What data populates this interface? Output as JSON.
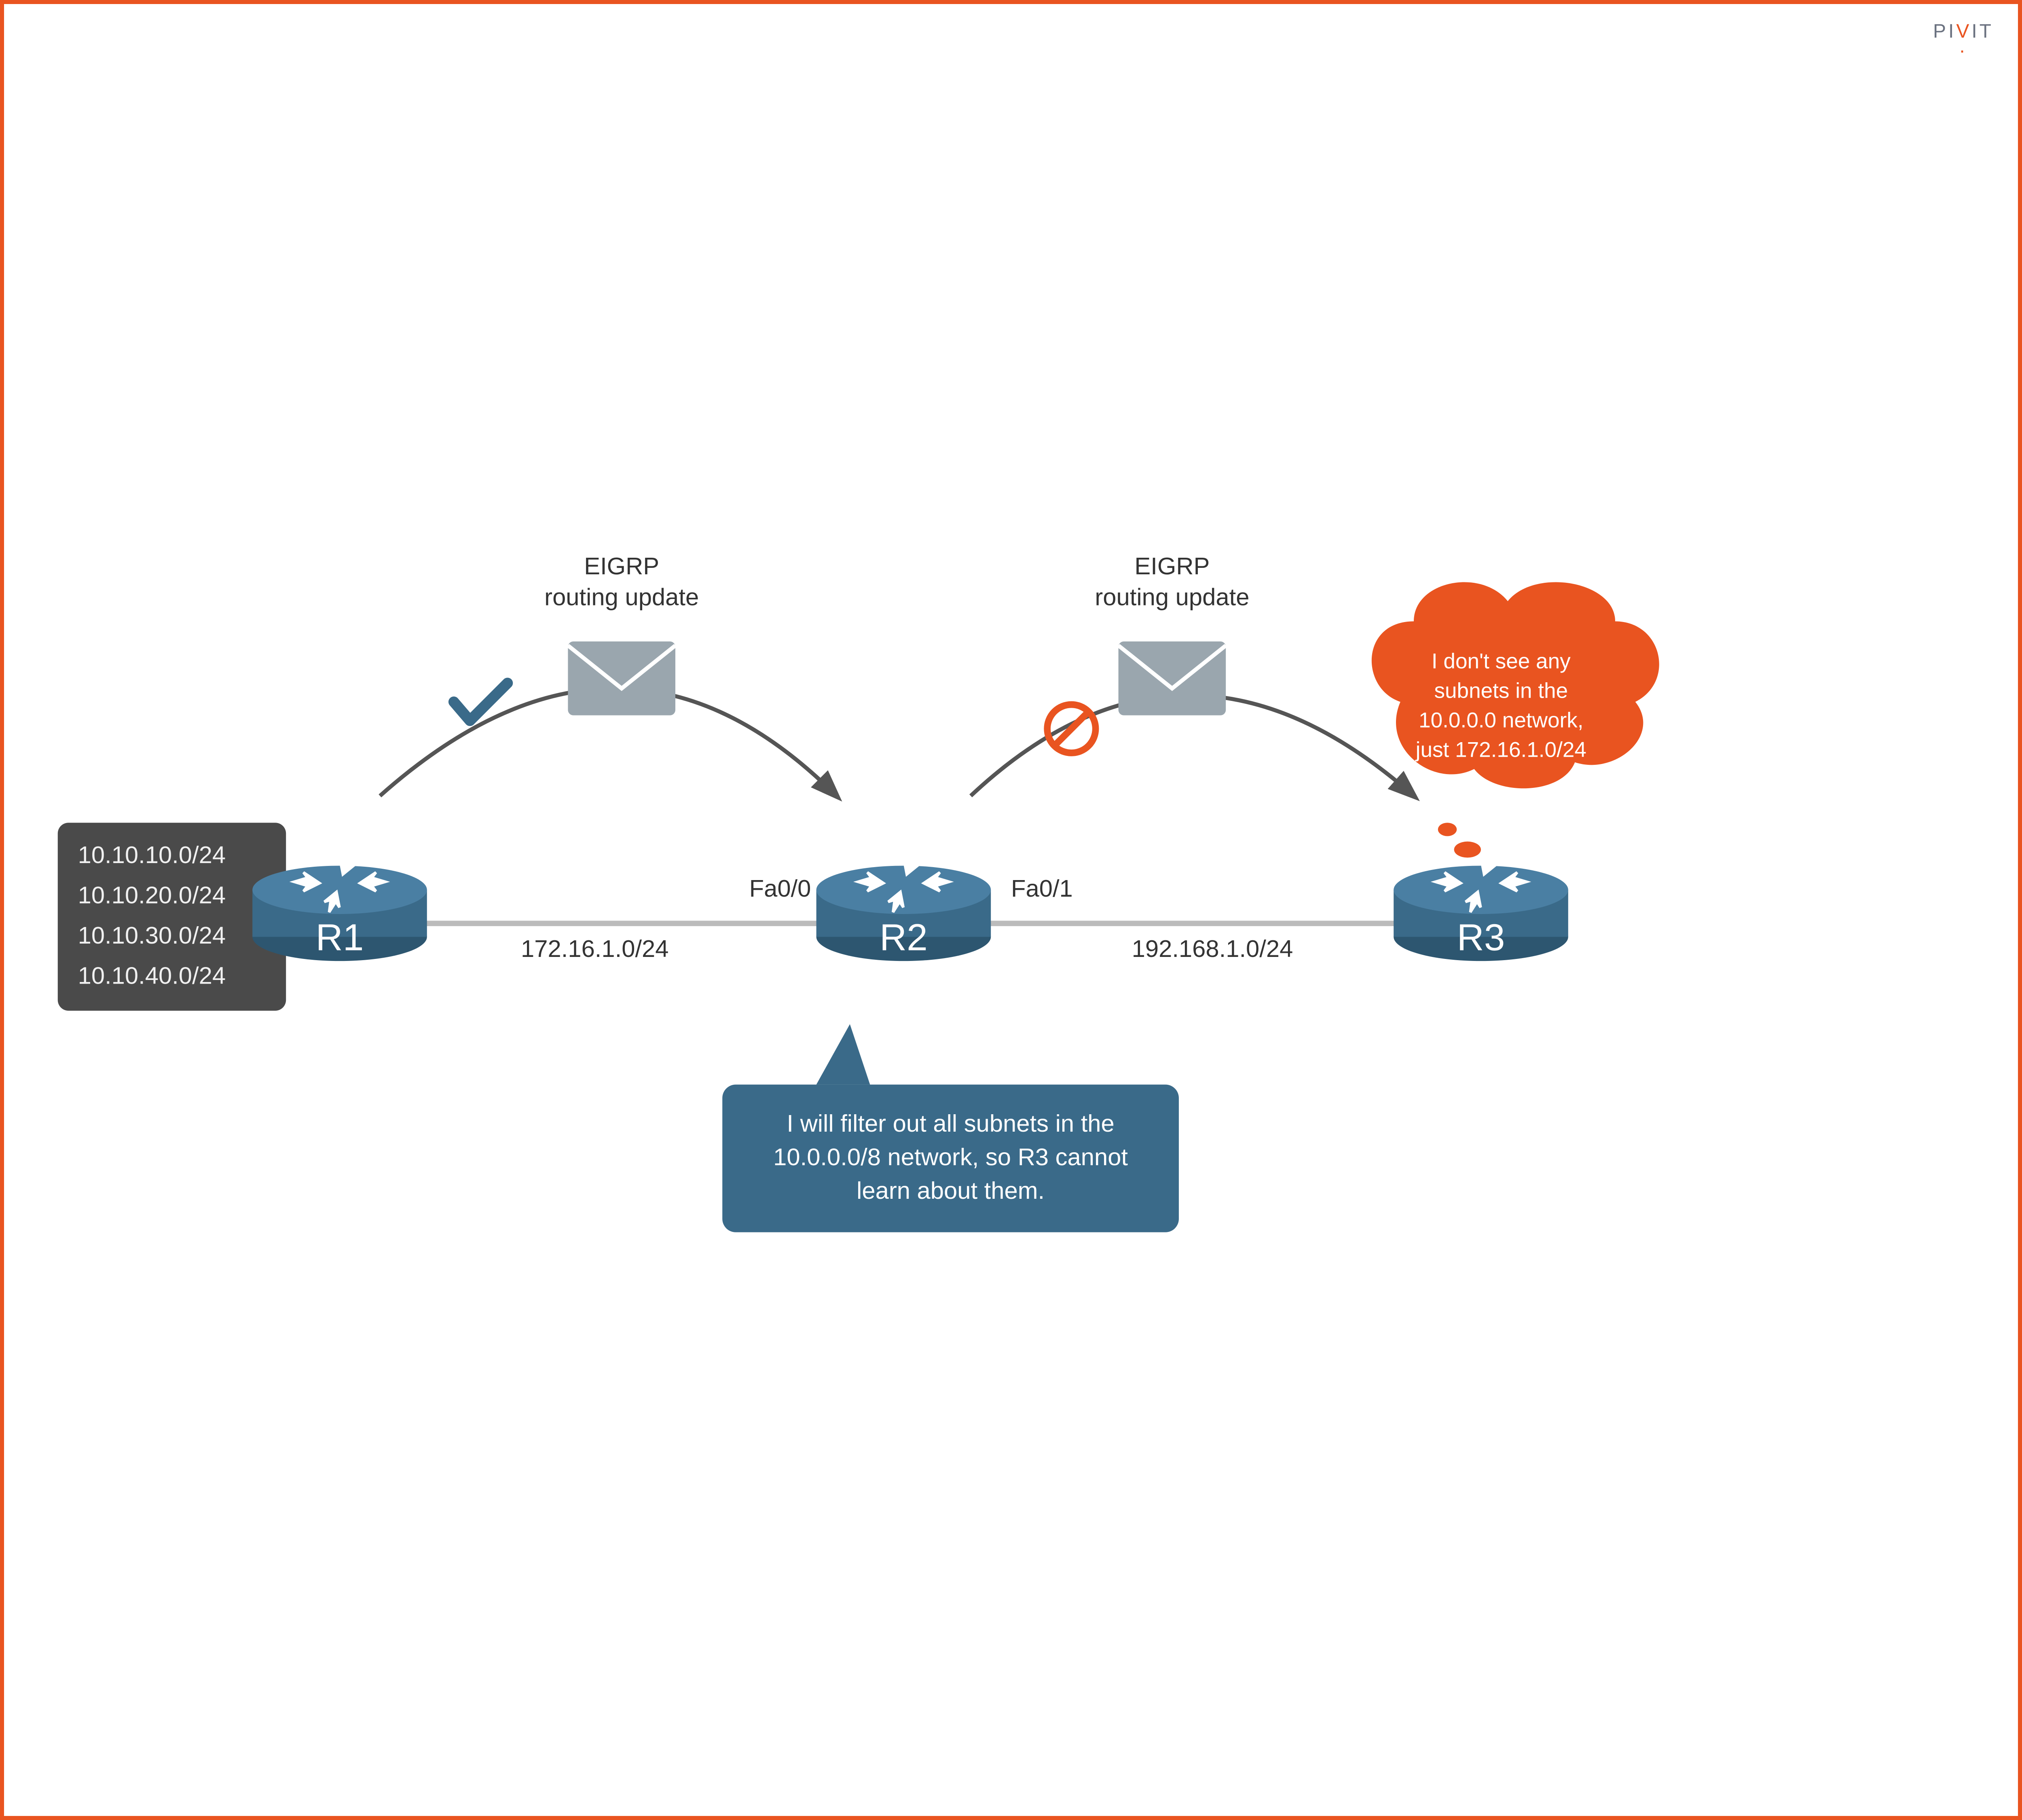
{
  "brand": {
    "name_left": "PI",
    "name_mid": "V",
    "name_right": "IT"
  },
  "subnets_box": [
    "10.10.10.0/24",
    "10.10.20.0/24",
    "10.10.30.0/24",
    "10.10.40.0/24"
  ],
  "routers": {
    "r1": "R1",
    "r2": "R2",
    "r3": "R3"
  },
  "interfaces": {
    "r2_left": "Fa0/0",
    "r2_right": "Fa0/1"
  },
  "links": {
    "r1_r2": "172.16.1.0/24",
    "r2_r3": "192.168.1.0/24"
  },
  "updates": {
    "left_line1": "EIGRP",
    "left_line2": "routing update",
    "right_line1": "EIGRP",
    "right_line2": "routing update"
  },
  "r2_callout_line1": "I will filter out all subnets in the",
  "r2_callout_line2": "10.0.0.0/8 network, so R3 cannot",
  "r2_callout_line3": "learn about them.",
  "r3_thought_line1": "I don't see any",
  "r3_thought_line2": "subnets in the",
  "r3_thought_line3": "10.0.0.0 network,",
  "r3_thought_line4": "just 172.16.1.0/24",
  "colors": {
    "accent": "#e95420",
    "router": "#3a6a89",
    "routerTop": "#4a7fa3",
    "muted": "#9aa6ae",
    "dark": "#4a4a4a",
    "callout": "#3a6a89"
  }
}
